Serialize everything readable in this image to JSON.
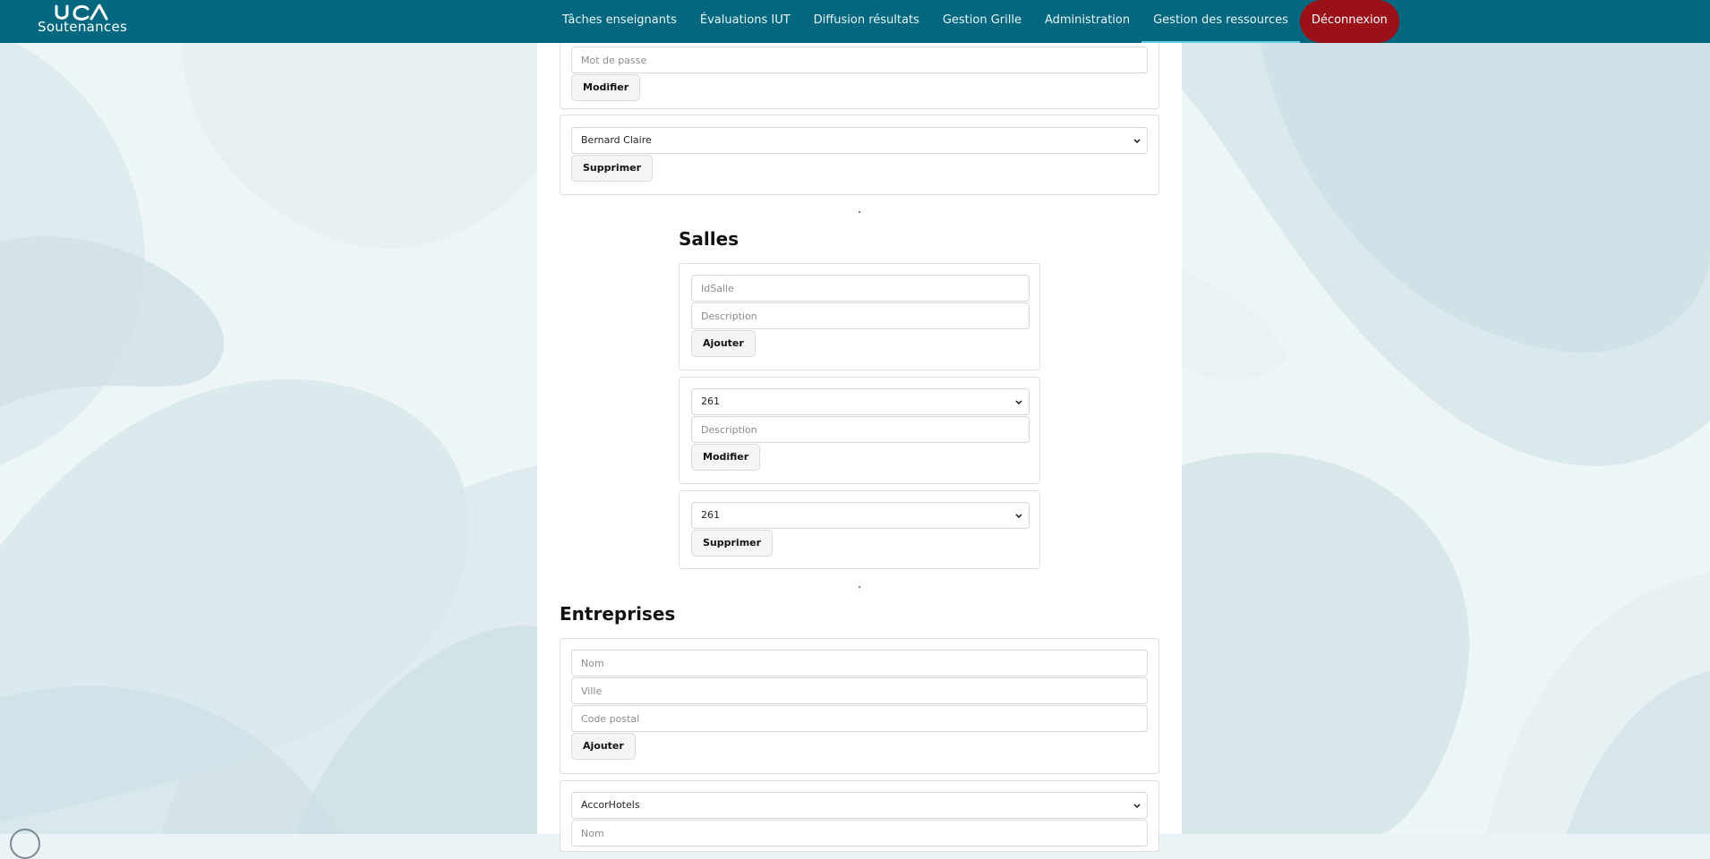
{
  "brand": {
    "name": "Soutenances",
    "logo_icon": "uca-logo-icon"
  },
  "nav": {
    "items": [
      {
        "label": "Tâches enseignants"
      },
      {
        "label": "Évaluations IUT"
      },
      {
        "label": "Diffusion résultats"
      },
      {
        "label": "Gestion Grille"
      },
      {
        "label": "Administration"
      },
      {
        "label": "Gestion des ressources"
      }
    ],
    "active_item": "Gestion des ressources",
    "logout": "Déconnexion"
  },
  "users": {
    "password_placeholder": "Mot de passe",
    "modify_button": "Modifier",
    "delete_select": "Bernard Claire",
    "delete_button": "Supprimer"
  },
  "rooms": {
    "title": "Salles",
    "add": {
      "id_placeholder": "IdSalle",
      "description_placeholder": "Description",
      "button": "Ajouter"
    },
    "modify": {
      "select_value": "261",
      "description_placeholder": "Description",
      "button": "Modifier"
    },
    "delete": {
      "select_value": "261",
      "button": "Supprimer"
    }
  },
  "companies": {
    "title": "Entreprises",
    "add": {
      "name_placeholder": "Nom",
      "city_placeholder": "Ville",
      "postal_placeholder": "Code postal",
      "button": "Ajouter"
    },
    "modify": {
      "select_value": "AccorHotels",
      "name_placeholder": "Nom"
    }
  },
  "colors": {
    "navbar": "#03687f",
    "logout": "#9a1118",
    "active_underline": "#5fd0df",
    "background": "#eaf3f5"
  }
}
